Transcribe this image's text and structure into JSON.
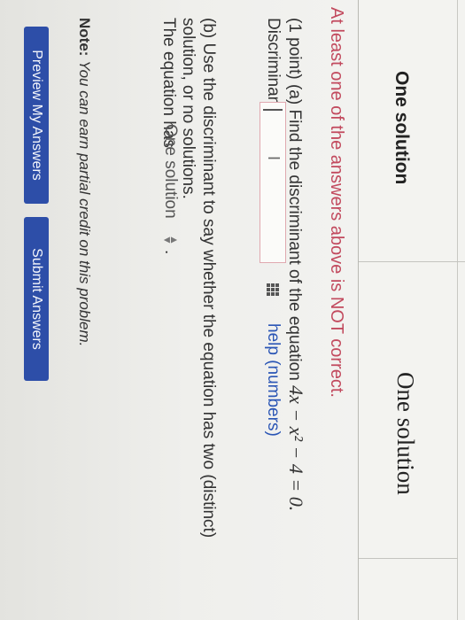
{
  "results": {
    "entered": "One solution",
    "answer_preview": "One solution"
  },
  "feedback": {
    "warning": "At least one of the answers above is NOT correct."
  },
  "problem": {
    "part_a_prefix": "(1 point) (a) Find the discriminant of the equation",
    "equation": "4x − x² − 4 = 0.",
    "discriminant_label": "Discriminant =",
    "discriminant_value": "",
    "help_link": "help (numbers)",
    "part_b_line1": "(b) Use the discriminant to say whether the equation has two (distinct)",
    "part_b_line2": "solution, or no solutions.",
    "equation_has_label": "The equation has",
    "equation_has_selected": "One solution",
    "period": "."
  },
  "note": {
    "label": "Note:",
    "text": "You can earn partial credit on this problem."
  },
  "buttons": {
    "preview": "Preview My Answers",
    "submit": "Submit Answers"
  },
  "colors": {
    "warning": "#c24a5e",
    "link": "#2a55b5",
    "button": "#2d4ea8"
  }
}
